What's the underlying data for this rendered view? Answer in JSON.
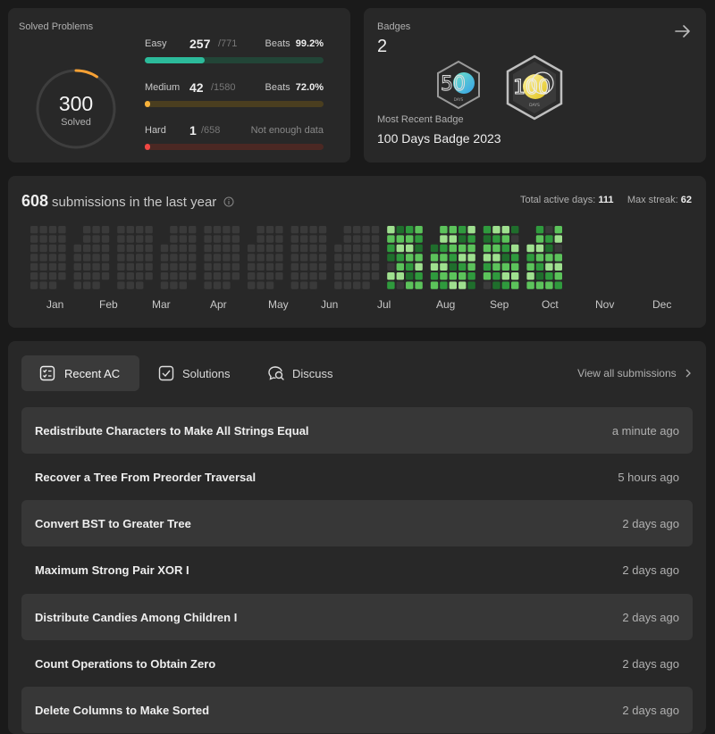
{
  "solved": {
    "title": "Solved Problems",
    "total": "300",
    "total_label": "Solved",
    "progress_fraction": 0.0916,
    "difficulties": [
      {
        "name": "Easy",
        "count": "257",
        "total": "/771",
        "beats_label": "Beats",
        "beats_value": "99.2%",
        "fraction": 0.333,
        "color": "#2cbb9b",
        "track": "#224537"
      },
      {
        "name": "Medium",
        "count": "42",
        "total": "/1580",
        "beats_label": "Beats",
        "beats_value": "72.0%",
        "fraction": 0.027,
        "color": "#f7b23b",
        "track": "#4a3e1f"
      },
      {
        "name": "Hard",
        "count": "1",
        "total": "/658",
        "beats_label": "Not enough data",
        "beats_value": "",
        "fraction": 0.0015,
        "color": "#ef4743",
        "track": "#4b2823"
      }
    ]
  },
  "badges": {
    "title": "Badges",
    "count": "2",
    "most_recent_label": "Most Recent Badge",
    "most_recent_name": "100 Days Badge 2023",
    "items": [
      {
        "icon": "50-days-badge-icon",
        "number": "50",
        "sub": "DAYS"
      },
      {
        "icon": "100-days-badge-icon",
        "number": "100",
        "sub": "DAYS"
      }
    ]
  },
  "submissions": {
    "count": "608",
    "label": "submissions in the last year",
    "active_days_label": "Total active days:",
    "active_days": "111",
    "max_streak_label": "Max streak:",
    "max_streak": "62",
    "months": [
      "Jan",
      "Feb",
      "Mar",
      "Apr",
      "May",
      "Jun",
      "Jul",
      "Aug",
      "Sep",
      "Oct",
      "Nov",
      "Dec"
    ],
    "colors": {
      "empty": "#3a3a3a",
      "l1": "#1f6e2c",
      "l2": "#2f9a3d",
      "l3": "#5cc35b",
      "l4": "#9fe08f"
    }
  },
  "recent": {
    "tabs": [
      {
        "label": "Recent AC",
        "icon": "checklist-icon",
        "active": true
      },
      {
        "label": "Solutions",
        "icon": "checkbox-icon",
        "active": false
      },
      {
        "label": "Discuss",
        "icon": "discuss-icon",
        "active": false
      }
    ],
    "view_all": "View all submissions",
    "rows": [
      {
        "title": "Redistribute Characters to Make All Strings Equal",
        "time": "a minute ago"
      },
      {
        "title": "Recover a Tree From Preorder Traversal",
        "time": "5 hours ago"
      },
      {
        "title": "Convert BST to Greater Tree",
        "time": "2 days ago"
      },
      {
        "title": "Maximum Strong Pair XOR I",
        "time": "2 days ago"
      },
      {
        "title": "Distribute Candies Among Children I",
        "time": "2 days ago"
      },
      {
        "title": "Count Operations to Obtain Zero",
        "time": "2 days ago"
      },
      {
        "title": "Delete Columns to Make Sorted",
        "time": "2 days ago"
      }
    ]
  }
}
